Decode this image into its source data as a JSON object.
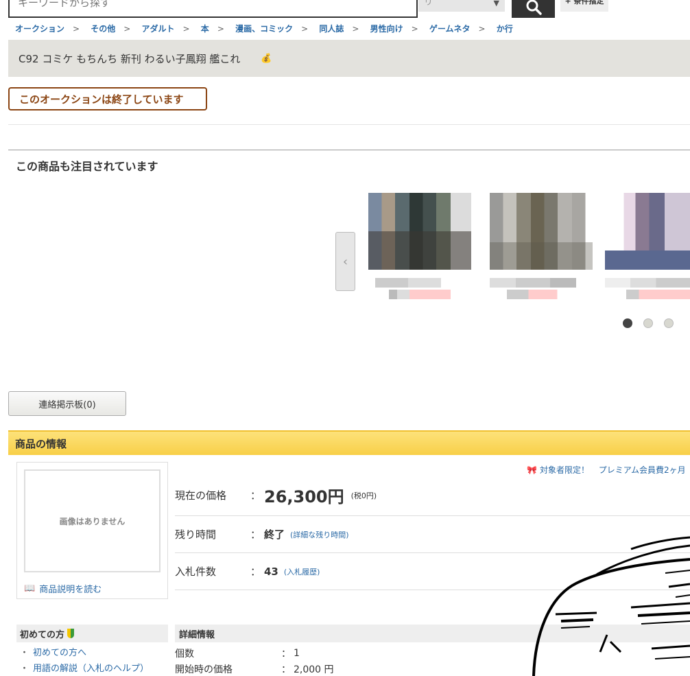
{
  "search": {
    "placeholder": "キーワードから探す",
    "category": "すべてのカテゴリ",
    "condition_label": "+ 条件指定"
  },
  "breadcrumb": [
    "オークション",
    "その他",
    "アダルト",
    "本",
    "漫画、コミック",
    "同人誌",
    "男性向け",
    "ゲームネタ",
    "か行"
  ],
  "breadcrumb_sep": ">",
  "item": {
    "title": "C92 コミケ もちんち 新刊 わるい子鳳翔 艦これ"
  },
  "status": {
    "ended_label": "このオークションは終了しています"
  },
  "related": {
    "title": "この商品も注目されています"
  },
  "board": {
    "label": "連絡掲示板(0)"
  },
  "info": {
    "header": "商品の情報",
    "no_image": "画像はありません",
    "read_description": "商品説明を読む",
    "promo_tag": "対象者限定！",
    "promo_text": "プレミアム会員費2ヶ月",
    "price_label": "現在の価格",
    "price_value": "26,300円",
    "price_tax": "(税0円)",
    "remaining_label": "残り時間",
    "remaining_value": "終了",
    "remaining_link": "(詳細な残り時間)",
    "bids_label": "入札件数",
    "bids_value": "43",
    "bids_link": "(入札履歴)",
    "colon": "："
  },
  "guide": {
    "title": "初めての方",
    "links": [
      "初めての方へ",
      "用語の解説（入札のヘルプ）"
    ]
  },
  "details": {
    "title": "詳細情報",
    "rows": [
      {
        "key": "個数",
        "value": "1"
      },
      {
        "key": "開始時の価格",
        "value": "2,000 円"
      }
    ]
  },
  "colors": {
    "link": "#2b6aa6",
    "ended": "#8b4513",
    "header_yellow": "#f8cf48",
    "title_bar": "#e3e2dd"
  }
}
